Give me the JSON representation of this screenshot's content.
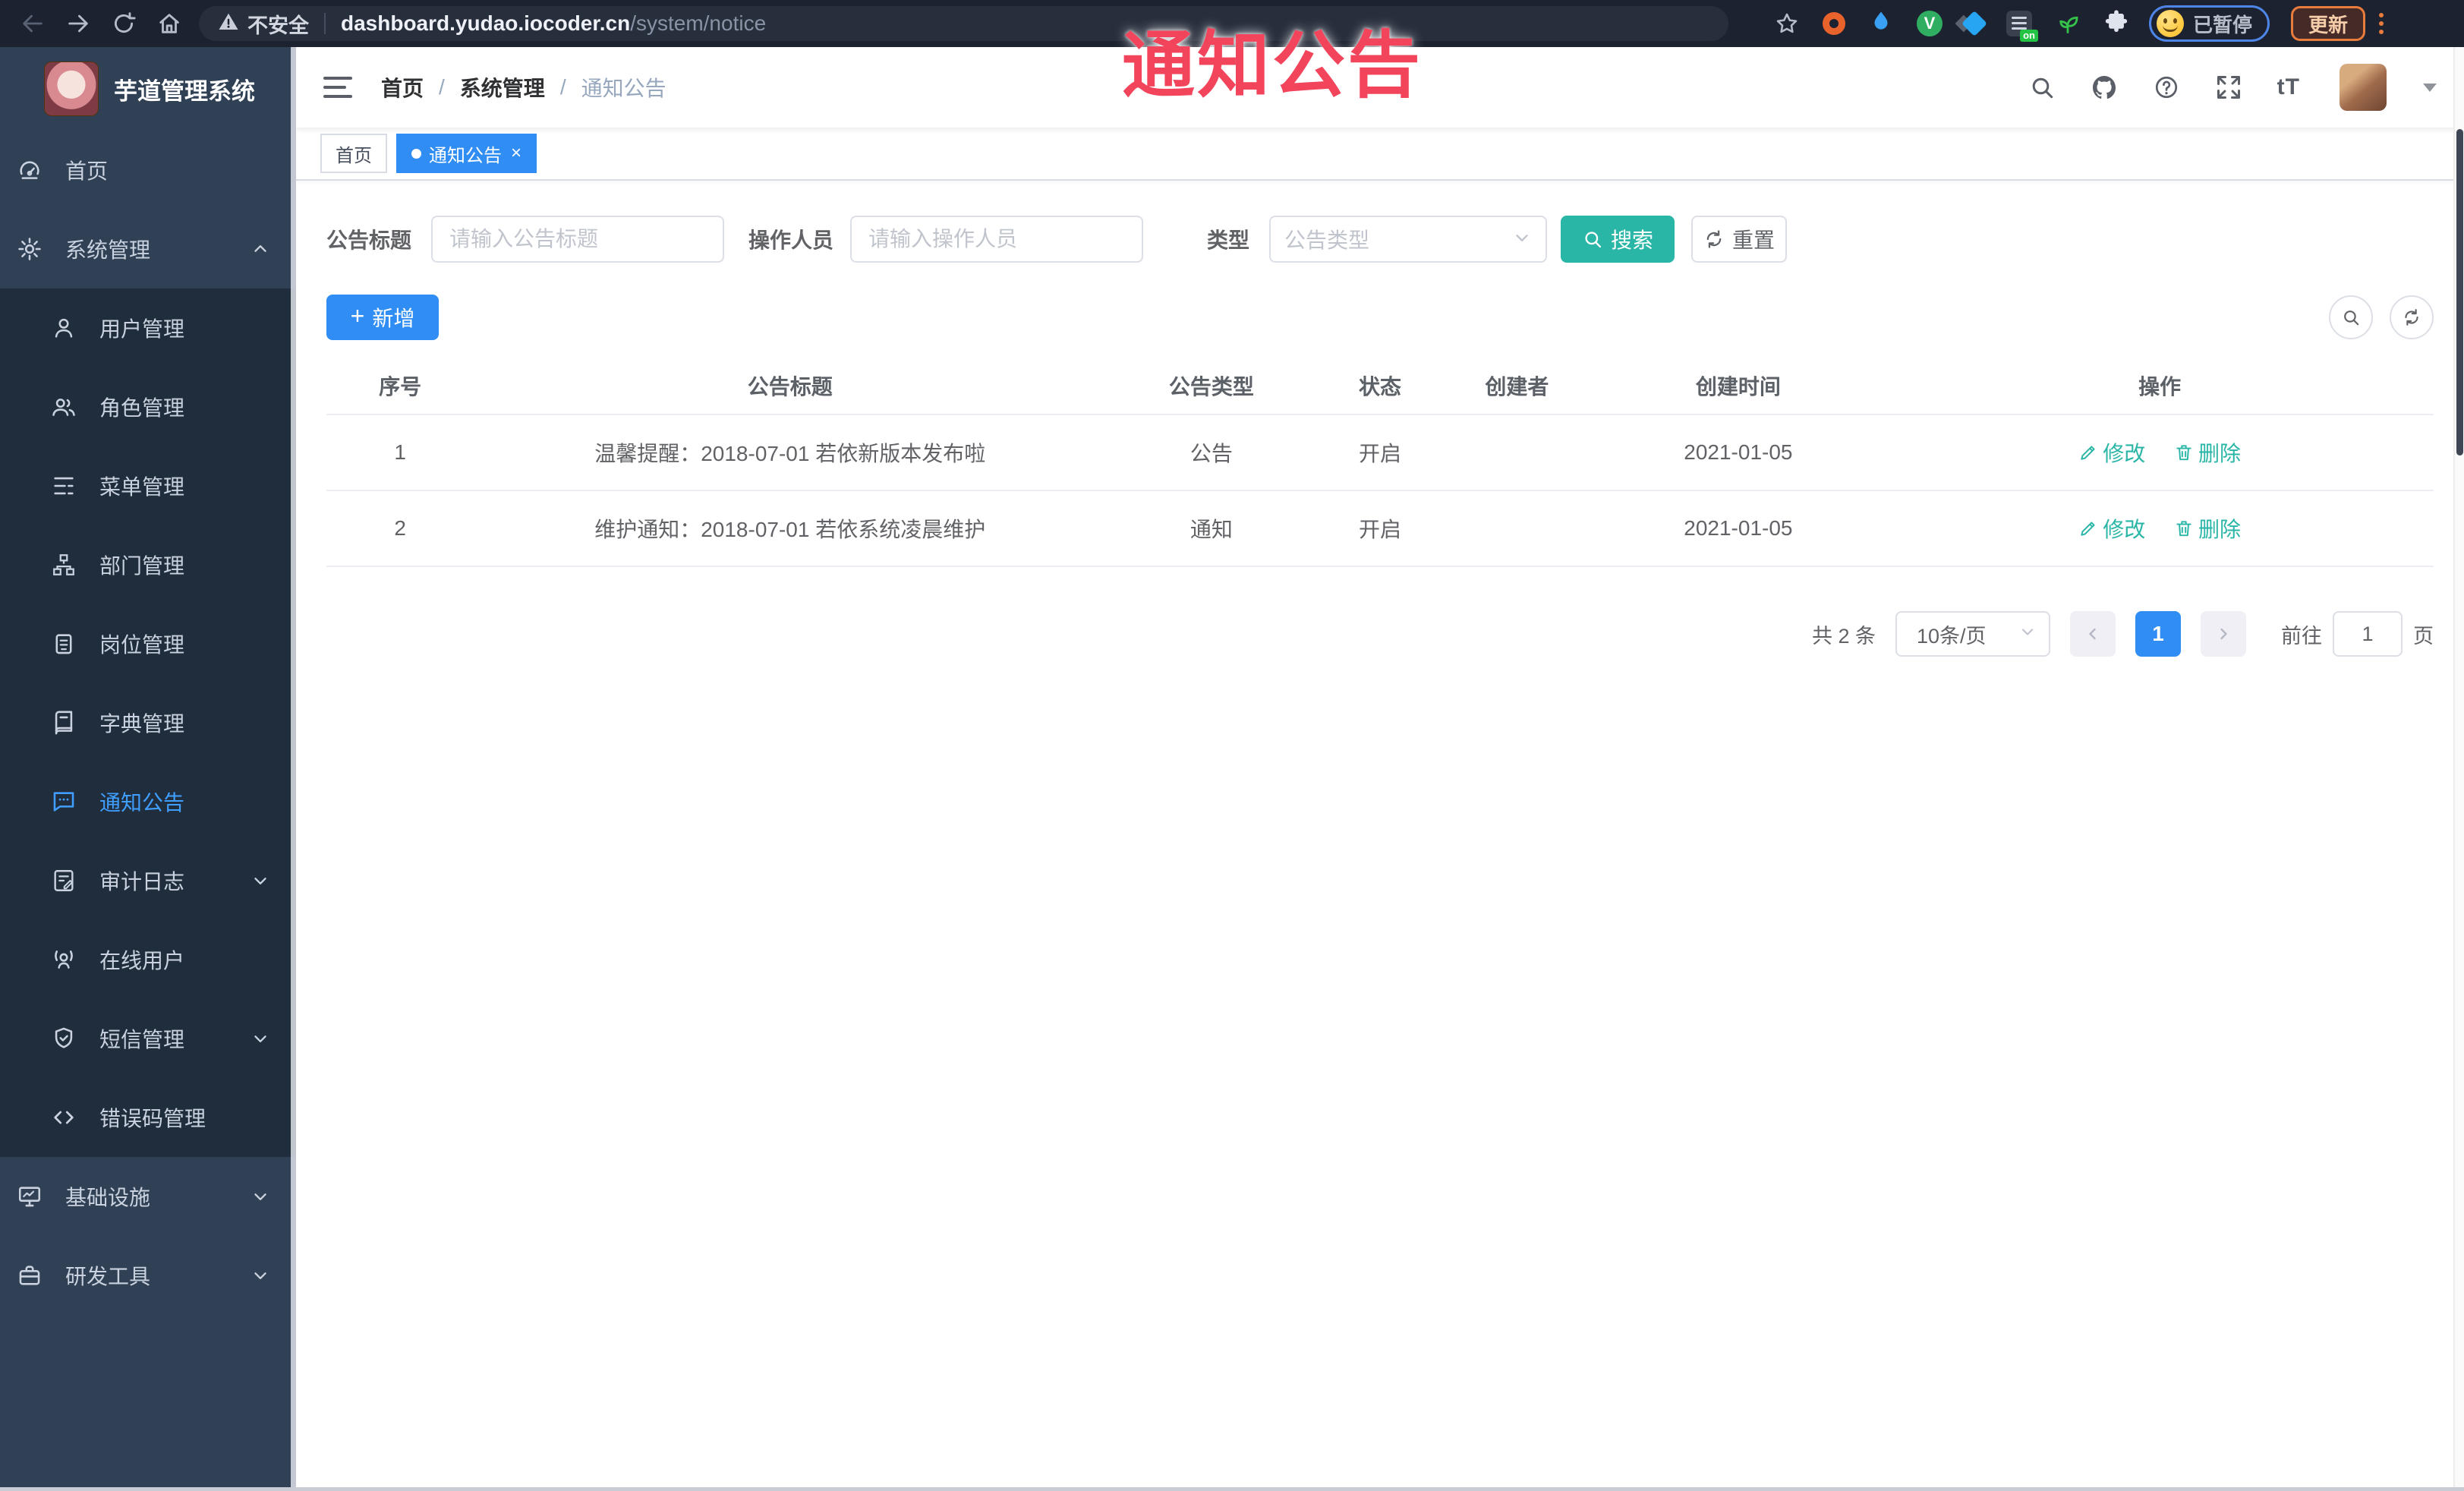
{
  "browser": {
    "security_label": "不安全",
    "url_host": "dashboard.yudao.iocoder.cn",
    "url_path": "/system/notice",
    "on_badge": "on",
    "paused_label": "已暂停",
    "update_label": "更新"
  },
  "overlay": {
    "title": "通知公告",
    "color": "#f2455c"
  },
  "sidebar": {
    "logo_title": "芋道管理系统",
    "items": [
      {
        "label": "首页",
        "icon": "dashboard-icon"
      },
      {
        "label": "系统管理",
        "icon": "gear-icon",
        "caret": "up"
      },
      {
        "label": "用户管理",
        "icon": "user-icon",
        "sub": true
      },
      {
        "label": "角色管理",
        "icon": "peoples-icon",
        "sub": true
      },
      {
        "label": "菜单管理",
        "icon": "menu-list-icon",
        "sub": true
      },
      {
        "label": "部门管理",
        "icon": "tree-icon",
        "sub": true
      },
      {
        "label": "岗位管理",
        "icon": "post-badge-icon",
        "sub": true
      },
      {
        "label": "字典管理",
        "icon": "dict-book-icon",
        "sub": true
      },
      {
        "label": "通知公告",
        "icon": "message-icon",
        "sub": true,
        "active": true
      },
      {
        "label": "审计日志",
        "icon": "log-edit-icon",
        "sub": true,
        "caret": "down"
      },
      {
        "label": "在线用户",
        "icon": "online-user-icon",
        "sub": true
      },
      {
        "label": "短信管理",
        "icon": "sms-shield-icon",
        "sub": true,
        "caret": "down"
      },
      {
        "label": "错误码管理",
        "icon": "code-icon",
        "sub": true
      },
      {
        "label": "基础设施",
        "icon": "monitor-icon",
        "caret": "down"
      },
      {
        "label": "研发工具",
        "icon": "toolbox-icon",
        "caret": "down"
      }
    ]
  },
  "header": {
    "breadcrumb": [
      "首页",
      "系统管理",
      "通知公告"
    ],
    "separator": "/",
    "font_icon": "tT"
  },
  "tags": {
    "items": [
      {
        "label": "首页"
      },
      {
        "label": "通知公告"
      }
    ],
    "close_glyph": "×"
  },
  "filters": {
    "title_label": "公告标题",
    "title_placeholder": "请输入公告标题",
    "operator_label": "操作人员",
    "operator_placeholder": "请输入操作人员",
    "type_label": "类型",
    "type_placeholder": "公告类型",
    "search_label": "搜索",
    "reset_label": "重置"
  },
  "toolbar": {
    "add_label": "新增",
    "plus_glyph": "+"
  },
  "table": {
    "columns": [
      "序号",
      "公告标题",
      "公告类型",
      "状态",
      "创建者",
      "创建时间",
      "操作"
    ],
    "rows": [
      {
        "index": "1",
        "title": "温馨提醒：2018-07-01 若依新版本发布啦",
        "type": "公告",
        "status": "开启",
        "creator": "",
        "create_time": "2021-01-05"
      },
      {
        "index": "2",
        "title": "维护通知：2018-07-01 若依系统凌晨维护",
        "type": "通知",
        "status": "开启",
        "creator": "",
        "create_time": "2021-01-05"
      }
    ],
    "edit_label": "修改",
    "delete_label": "删除"
  },
  "pagination": {
    "total": "共 2 条",
    "page_size": "10条/页",
    "current_page": "1",
    "goto_label": "前往",
    "goto_value": "1",
    "page_unit": "页"
  },
  "colors": {
    "primary": "#2f8df4",
    "success_teal": "#29b6a6",
    "sidebar_bg": "#304156",
    "submenu_bg": "#1f2d3d",
    "active_menu": "#409eff",
    "overlay_red": "#f2455c"
  }
}
